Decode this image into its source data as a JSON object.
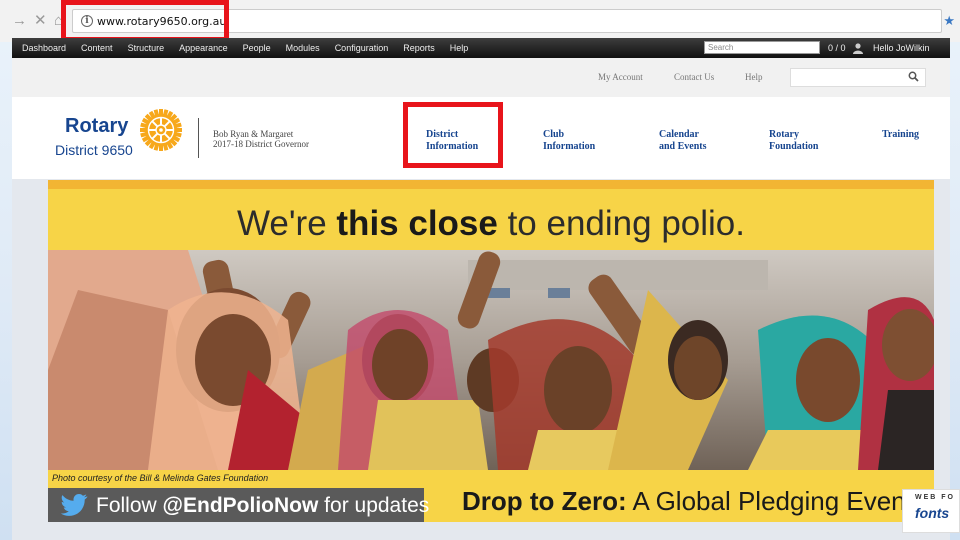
{
  "browser": {
    "back_glyph": "→",
    "close_glyph": "✕",
    "home_glyph": "⌂",
    "url": "www.rotary9650.org.au",
    "info_glyph": "i",
    "star_glyph": "★"
  },
  "admin_bar": {
    "menu": [
      "Dashboard",
      "Content",
      "Structure",
      "Appearance",
      "People",
      "Modules",
      "Configuration",
      "Reports",
      "Help"
    ],
    "search_placeholder": "Search",
    "count": "0 / 0",
    "hello": "Hello JoWilkin"
  },
  "utility_nav": {
    "my_account": "My Account",
    "contact_us": "Contact Us",
    "help": "Help"
  },
  "site_header": {
    "logo_word": "Rotary",
    "logo_district": "District 9650",
    "governor_line1": "Bob Ryan & Margaret",
    "governor_line2": "2017-18 District Governor",
    "nav": [
      {
        "line1": "District",
        "line2": "Information"
      },
      {
        "line1": "Club",
        "line2": "Information"
      },
      {
        "line1": "Calendar",
        "line2": "and Events"
      },
      {
        "line1": "Rotary",
        "line2": "Foundation"
      },
      {
        "line1": "Training",
        "line2": ""
      }
    ]
  },
  "hero": {
    "headline_pre": "We're ",
    "headline_bold": "this close",
    "headline_post": " to ending polio.",
    "credit": "Photo courtesy of the Bill & Melinda Gates Foundation",
    "follow_pre": "Follow ",
    "follow_handle": "@EndPolioNow",
    "follow_post": " for updates",
    "drop_bold": "Drop to Zero:",
    "drop_rest": " A Global Pledging Event"
  },
  "webfont_badge": {
    "top": "WEB FO",
    "bottom": "fonts"
  },
  "colors": {
    "rotary_blue": "#17458f",
    "rotary_gold": "#f7a81b",
    "highlight_red": "#e8141b",
    "hero_yellow": "#f7d447"
  },
  "icons": [
    "info-icon",
    "star-icon",
    "user-icon",
    "search-icon",
    "twitter-bird-icon",
    "rotary-wheel-icon"
  ]
}
